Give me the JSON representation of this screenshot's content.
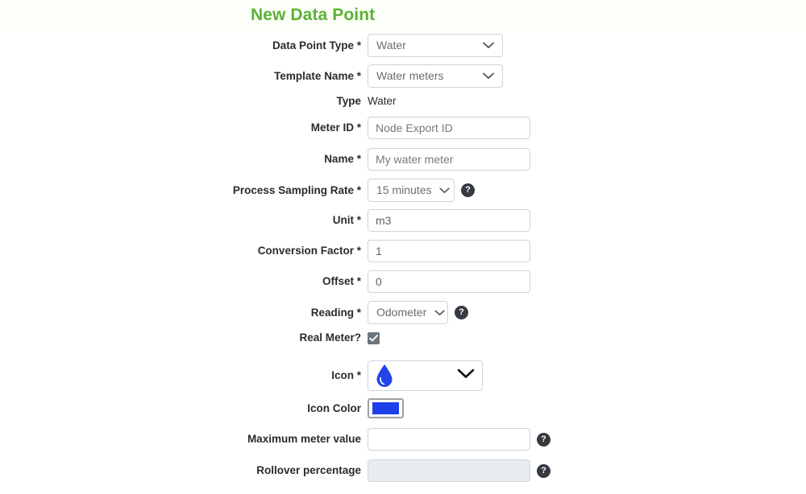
{
  "page": {
    "title": "New Data Point",
    "title_color": "#5cb136",
    "background": "#ffffff"
  },
  "form": {
    "data_point_type": {
      "label": "Data Point Type",
      "required_marker": "*",
      "value": "Water"
    },
    "template_name": {
      "label": "Template Name",
      "required_marker": "*",
      "value": "Water meters"
    },
    "type": {
      "label": "Type",
      "value": "Water"
    },
    "meter_id": {
      "label": "Meter ID",
      "required_marker": "*",
      "value": "",
      "placeholder": "Node Export ID"
    },
    "name": {
      "label": "Name",
      "required_marker": "*",
      "value": "",
      "placeholder": "My water meter"
    },
    "process_sampling_rate": {
      "label": "Process Sampling Rate",
      "required_marker": "*",
      "value": "15 minutes",
      "help": "?"
    },
    "unit": {
      "label": "Unit",
      "required_marker": "*",
      "value": "m3",
      "placeholder": ""
    },
    "conversion_factor": {
      "label": "Conversion Factor",
      "required_marker": "*",
      "value": "1",
      "placeholder": ""
    },
    "offset": {
      "label": "Offset",
      "required_marker": "*",
      "value": "0",
      "placeholder": ""
    },
    "reading": {
      "label": "Reading",
      "required_marker": "*",
      "value": "Odometer",
      "help": "?"
    },
    "real_meter": {
      "label": "Real Meter?",
      "checked": true
    },
    "icon": {
      "label": "Icon",
      "required_marker": "*",
      "icon_name": "water-drop-icon",
      "icon_color": "#2244e8"
    },
    "icon_color": {
      "label": "Icon Color",
      "value": "#1f3fe8"
    },
    "maximum_meter_value": {
      "label": "Maximum meter value",
      "value": "",
      "placeholder": "",
      "help": "?"
    },
    "rollover_percentage": {
      "label": "Rollover percentage",
      "value": "",
      "placeholder": "",
      "disabled": true,
      "help": "?"
    }
  }
}
